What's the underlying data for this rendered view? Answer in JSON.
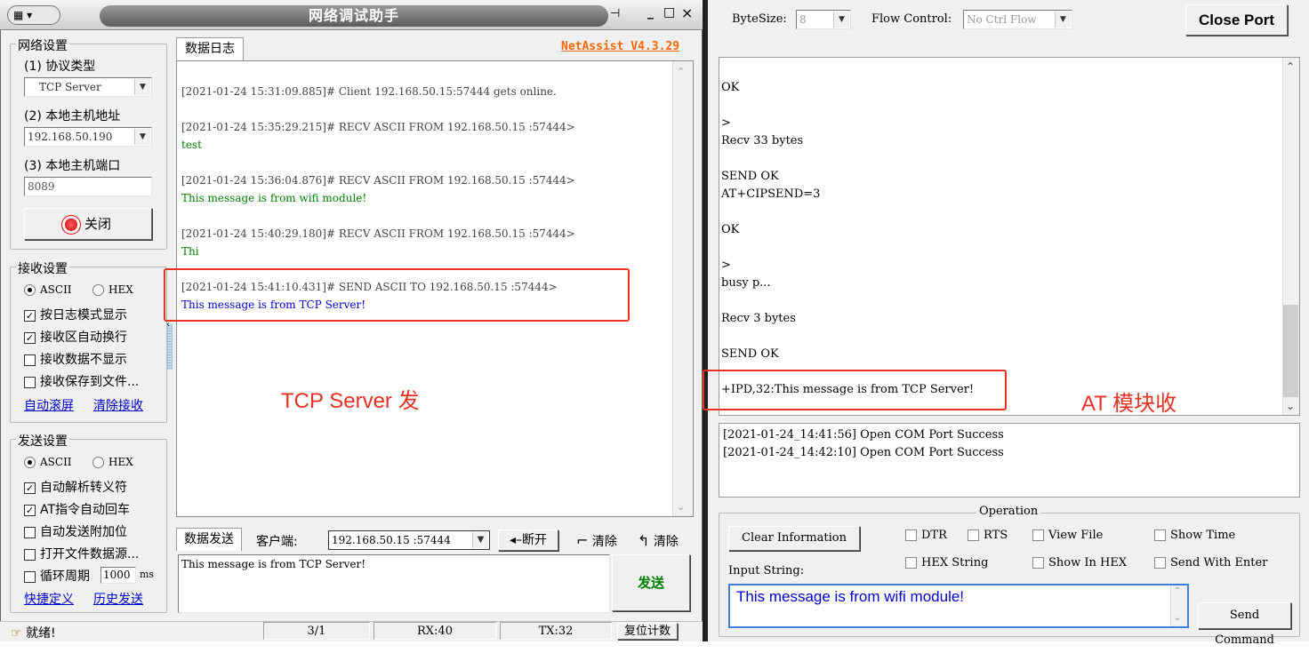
{
  "left": {
    "title": "网络调试助手",
    "title_btns": [
      "_",
      "□",
      "×"
    ],
    "net": {
      "group_label": "网络设置",
      "protocol_label": "(1) 协议类型",
      "protocol_value": "TCP Server",
      "host_label": "(2) 本地主机地址",
      "host_value": "192.168.50.190",
      "port_label": "(3) 本地主机端口",
      "port_value": "8089",
      "close_btn": "关闭"
    },
    "recv": {
      "group_label": "接收设置",
      "ascii": "ASCII",
      "hex": "HEX",
      "opts": [
        "按日志模式显示",
        "接收区自动换行",
        "接收数据不显示",
        "接收保存到文件..."
      ],
      "auto_scroll": "自动滚屏",
      "clear_recv": "清除接收"
    },
    "send": {
      "group_label": "发送设置",
      "ascii": "ASCII",
      "hex": "HEX",
      "opts": [
        "自动解析转义符",
        "AT指令自动回车",
        "自动发送附加位",
        "打开文件数据源..."
      ],
      "cycle_label": "循环周期",
      "cycle_value": "1000",
      "cycle_unit": "ms",
      "shortcut": "快捷定义",
      "history": "历史发送"
    },
    "log": {
      "tab": "数据日志",
      "brand": "NetAssist V4.3.29",
      "entries": [
        {
          "head": "[2021-01-24 15:31:09.885]# Client 192.168.50.15:57444 gets online.",
          "body": ""
        },
        {
          "head": "[2021-01-24 15:35:29.215]# RECV ASCII FROM 192.168.50.15 :57444>",
          "body": "test"
        },
        {
          "head": "[2021-01-24 15:36:04.876]# RECV ASCII FROM 192.168.50.15 :57444>",
          "body": "This message is from wifi module!"
        },
        {
          "head": "[2021-01-24 15:40:29.180]# RECV ASCII FROM 192.168.50.15 :57444>",
          "body": "Thi"
        },
        {
          "head": "[2021-01-24 15:41:10.431]# SEND ASCII TO 192.168.50.15 :57444>",
          "body": "This message is from TCP Server!"
        }
      ],
      "annotation": "TCP Server 发"
    },
    "sendbar": {
      "tab": "数据发送",
      "client_label": "客户端:",
      "client_value": "192.168.50.15 :57444",
      "disconnect": "断开",
      "clear1": "清除",
      "clear2": "清除",
      "input": "This message is from TCP Server!",
      "send_btn": "发送"
    },
    "status": {
      "ready": "就绪!",
      "count": "3/1",
      "rx": "RX:40",
      "tx": "TX:32",
      "reset": "复位计数"
    }
  },
  "right": {
    "bytesize_label": "ByteSize:",
    "bytesize_value": "8",
    "flow_label": "Flow Control:",
    "flow_value": "No Ctrl Flow",
    "close_port": "Close Port",
    "recv_lines": [
      "OK",
      "",
      ">",
      "Recv 33 bytes",
      "",
      "SEND OK",
      "AT+CIPSEND=3",
      "",
      "OK",
      "",
      ">",
      "busy p...",
      "",
      "Recv 3 bytes",
      "",
      "SEND OK",
      "",
      "+IPD,32:This message is from TCP Server!"
    ],
    "annotation": "AT 模块收",
    "info_lines": [
      "[2021-01-24_14:41:56] Open COM Port Success",
      "[2021-01-24_14:42:10] Open COM Port Success"
    ],
    "operation": {
      "label": "Operation",
      "clear_info": "Clear Information",
      "checks": [
        "DTR",
        "RTS",
        "View File",
        "Show Time",
        "HEX String",
        "Show In HEX",
        "Send With Enter"
      ],
      "input_label": "Input String:",
      "input_value": "This message is from wifi module!",
      "send_cmd": "Send Command"
    }
  }
}
